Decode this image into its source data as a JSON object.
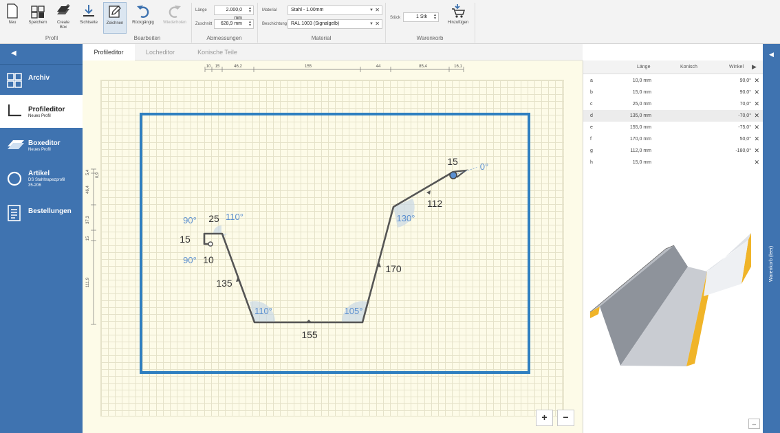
{
  "ribbon": {
    "buttons": {
      "neu": "Neu",
      "speichern": "Speichern",
      "create_box": "Create Box",
      "sichtseite": "Sichtseite",
      "zeichnen": "Zeichnen",
      "rueckgaengig": "Rückgängig",
      "wiederholen": "Wiederholen",
      "hinzufuegen": "Hinzufügen"
    },
    "groups": {
      "profil": "Profil",
      "bearbeiten": "Bearbeiten",
      "abmessungen": "Abmessungen",
      "material": "Material",
      "warenkorb": "Warenkorb"
    },
    "fields": {
      "laenge_label": "Länge",
      "laenge_value": "2.000,0 mm",
      "zuschnitt_label": "Zuschnitt",
      "zuschnitt_value": "628,9 mm",
      "material_label": "Material",
      "material_value": "Stahl - 1.00mm",
      "beschichtung_label": "Beschichtung",
      "beschichtung_value": "RAL 1003 (Signalgelb)",
      "stueck_label": "Stück",
      "stueck_value": "1 Stk"
    }
  },
  "nav": {
    "items": [
      {
        "title": "Archiv",
        "sub": ""
      },
      {
        "title": "Profileditor",
        "sub": "Neues Profil"
      },
      {
        "title": "Boxeditor",
        "sub": "Neues Profil"
      },
      {
        "title": "Artikel",
        "sub": "DS Stahltrapezprofil",
        "sub2": "35-206"
      },
      {
        "title": "Bestellungen",
        "sub": ""
      }
    ]
  },
  "tabs": [
    "Profileditor",
    "Locheditor",
    "Konische Teile"
  ],
  "drawing": {
    "top_dims": [
      "10",
      "15",
      "46,2",
      "155",
      "44",
      "85,4",
      "16,1"
    ],
    "left_dims": [
      "5,4",
      "0,9",
      "46,4",
      "37,3",
      "15",
      "111,9"
    ],
    "seg_labels": [
      "15",
      "10",
      "25",
      "135",
      "155",
      "170",
      "112",
      "15"
    ],
    "angle_labels": [
      "90°",
      "90°",
      "110°",
      "110°",
      "105°",
      "130°",
      "0°"
    ],
    "zoom_in": "+",
    "zoom_out": "−"
  },
  "table": {
    "headers": {
      "laenge": "Länge",
      "konisch": "Konisch",
      "winkel": "Winkel"
    },
    "rows": [
      {
        "letter": "a",
        "length": "10,0 mm",
        "angle": "90,0°"
      },
      {
        "letter": "b",
        "length": "15,0 mm",
        "angle": "90,0°"
      },
      {
        "letter": "c",
        "length": "25,0 mm",
        "angle": "70,0°"
      },
      {
        "letter": "d",
        "length": "135,0 mm",
        "angle": "-70,0°"
      },
      {
        "letter": "e",
        "length": "155,0 mm",
        "angle": "-75,0°"
      },
      {
        "letter": "f",
        "length": "170,0 mm",
        "angle": "50,0°"
      },
      {
        "letter": "g",
        "length": "112,0 mm",
        "angle": "-180,0°"
      },
      {
        "letter": "h",
        "length": "15,0 mm",
        "angle": ""
      }
    ]
  },
  "warenkorb": {
    "label": "Warenkorb (leer)"
  },
  "colors": {
    "accent": "#3f73b0",
    "frame": "#2f7fc0",
    "profile": "#555555",
    "angle": "#5b8fcf",
    "yellow": "#f0b429"
  }
}
